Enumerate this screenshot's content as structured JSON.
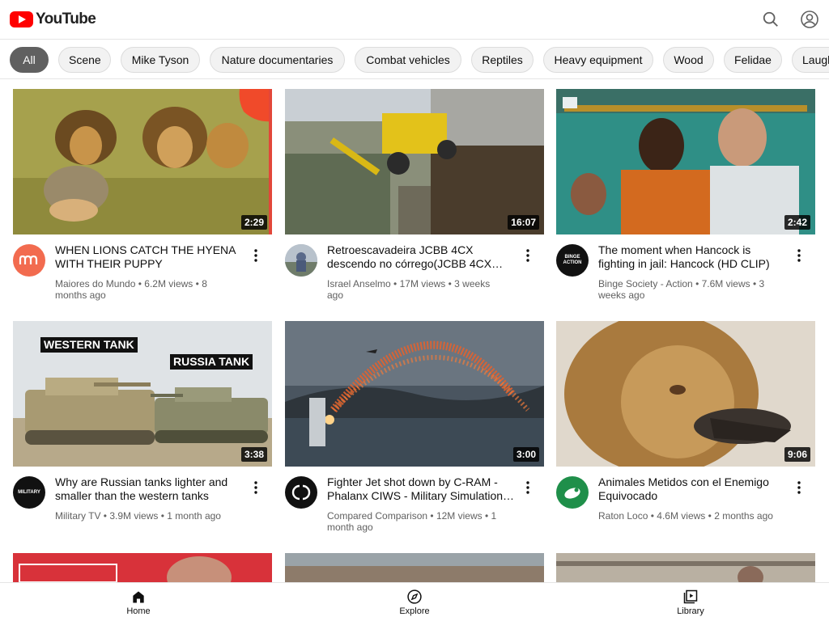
{
  "app": {
    "name": "YouTube"
  },
  "header": {
    "logo_text": "YouTube",
    "search_icon": "search-icon",
    "account_icon": "account-icon"
  },
  "chips": [
    {
      "label": "All",
      "active": true
    },
    {
      "label": "Scene"
    },
    {
      "label": "Mike Tyson"
    },
    {
      "label": "Nature documentaries"
    },
    {
      "label": "Combat vehicles"
    },
    {
      "label": "Reptiles"
    },
    {
      "label": "Heavy equipment"
    },
    {
      "label": "Wood"
    },
    {
      "label": "Felidae"
    },
    {
      "label": "Laugh"
    }
  ],
  "videos": [
    {
      "title": "WHEN LIONS CATCH THE HYENA WITH THEIR PUPPY",
      "channel": "Maiores do Mundo",
      "views": "6.2M views",
      "age": "8 months ago",
      "duration": "2:29"
    },
    {
      "title": "Retroescavadeira JCBB 4CX descendo no córrego(JCBB 4CX…",
      "channel": "Israel Anselmo",
      "views": "17M views",
      "age": "3 weeks ago",
      "duration": "16:07"
    },
    {
      "title": "The moment when Hancock is fighting in jail: Hancock (HD CLIP)",
      "channel": "Binge Society - Action",
      "views": "7.6M views",
      "age": "3 weeks ago",
      "duration": "2:42",
      "avatar_text": "BINGE ACTION"
    },
    {
      "title": "Why are Russian tanks lighter and smaller than the western tanks",
      "channel": "Military TV",
      "views": "3.9M views",
      "age": "1 month ago",
      "duration": "3:38",
      "thumb_text_1": "WESTERN TANK",
      "thumb_text_2": "RUSSIA TANK",
      "avatar_text": "MILITARY"
    },
    {
      "title": "Fighter Jet shot down by C-RAM - Phalanx CIWS - Military Simulation…",
      "channel": "Compared Comparison",
      "views": "12M views",
      "age": "1 month ago",
      "duration": "3:00"
    },
    {
      "title": "Animales Metidos con el Enemigo Equivocado",
      "channel": "Raton Loco",
      "views": "4.6M views",
      "age": "2 months ago",
      "duration": "9:06"
    }
  ],
  "bottom_nav": [
    {
      "label": "Home",
      "icon": "home-icon"
    },
    {
      "label": "Explore",
      "icon": "compass-icon"
    },
    {
      "label": "Library",
      "icon": "library-icon"
    }
  ],
  "colors": {
    "brand_red": "#ff0000",
    "active_chip": "#606060",
    "meta_text": "#606060"
  },
  "dot": "•"
}
